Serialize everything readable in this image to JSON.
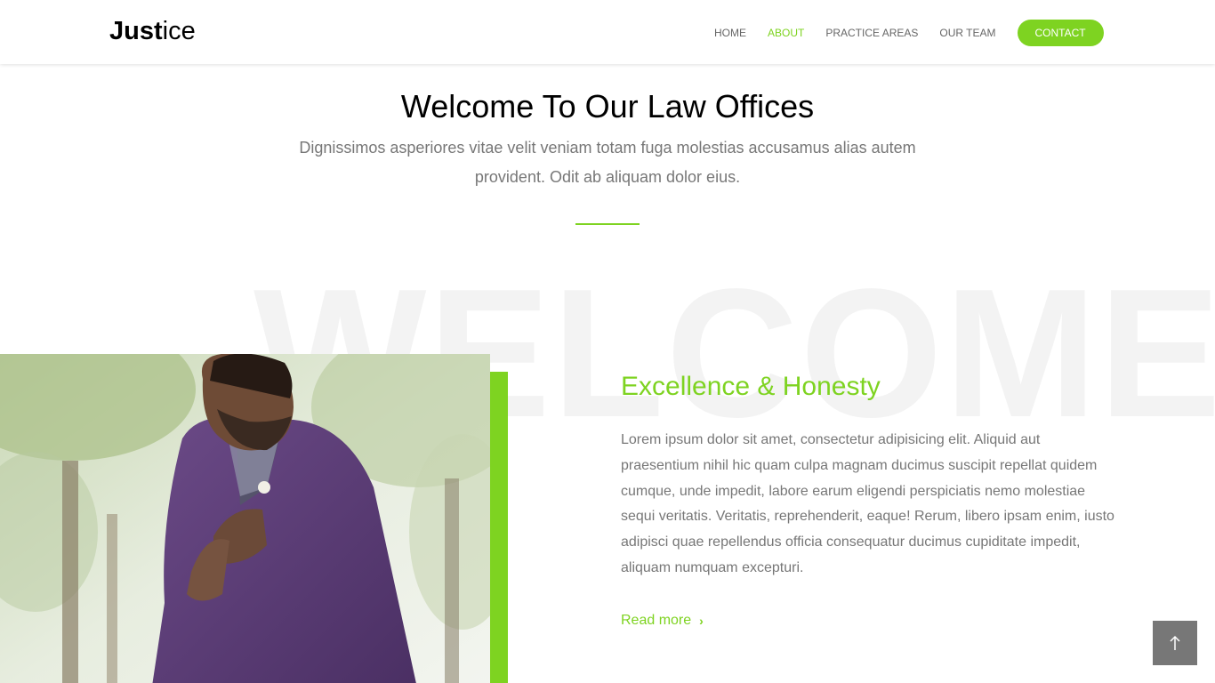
{
  "header": {
    "logo": {
      "bold": "Just",
      "light": "ice"
    },
    "nav": [
      {
        "label": "HOME",
        "active": false
      },
      {
        "label": "ABOUT",
        "active": true
      },
      {
        "label": "PRACTICE AREAS",
        "active": false
      },
      {
        "label": "OUR TEAM",
        "active": false
      }
    ],
    "contact_label": "CONTACT"
  },
  "intro": {
    "title": "Welcome To Our Law Offices",
    "text": "Dignissimos asperiores vitae velit veniam totam fuga molestias accusamus alias autem provident. Odit ab aliquam dolor eius."
  },
  "watermark": "WELCOME",
  "content": {
    "title": "Excellence & Honesty",
    "text": "Lorem ipsum dolor sit amet, consectetur adipisicing elit. Aliquid aut praesentium nihil hic quam culpa magnam ducimus suscipit repellat quidem cumque, unde impedit, labore earum eligendi perspiciatis nemo molestiae sequi veritatis. Veritatis, reprehenderit, eaque! Rerum, libero ipsam enim, iusto adipisci quae repellendus officia consequatur ducimus cupiditate impedit, aliquam numquam excepturi.",
    "read_more": "Read more"
  },
  "icons": {
    "read_more": "chevron-right-icon",
    "to_top": "arrow-up-icon"
  },
  "colors": {
    "accent": "#7ed321",
    "text_muted": "#777777",
    "to_top_bg": "#777777",
    "watermark": "#f3f3f3"
  }
}
